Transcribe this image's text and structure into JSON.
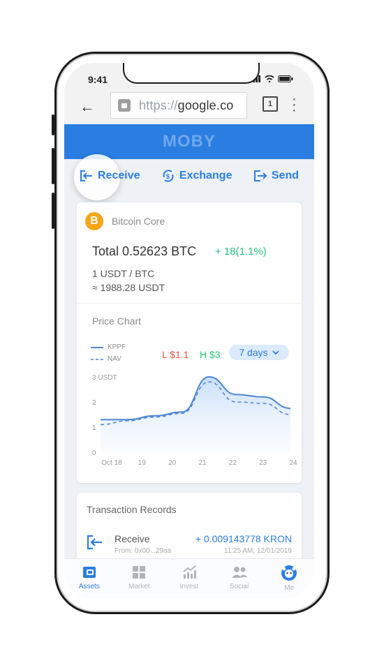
{
  "status_bar": {
    "time": "9:41"
  },
  "browser": {
    "url_prefix": "https://",
    "url_host": "google.co",
    "tab_count": "1"
  },
  "header": {
    "title": "MOBY",
    "color": "#2a7de1"
  },
  "actions": [
    {
      "label": "Receive",
      "icon": "receive-icon"
    },
    {
      "label": "Exchange",
      "icon": "exchange-icon"
    },
    {
      "label": "Send",
      "icon": "send-icon"
    }
  ],
  "wallet": {
    "coin_name": "Bitcoin Core",
    "coin_symbol": "B",
    "total": "Total 0.52623 BTC",
    "change": "+ 18(1.1%)",
    "rate_line1": "1 USDT / BTC",
    "rate_line2": "≈ 1988.28 USDT"
  },
  "price_chart": {
    "title": "Price Chart",
    "low": "L $1.1",
    "high": "H $3",
    "range_label": "7 days"
  },
  "chart_data": {
    "type": "area",
    "x": [
      "Oct 18",
      "19",
      "20",
      "21",
      "22",
      "23",
      "24"
    ],
    "y_ticks": [
      "3 USDT",
      "2",
      "1",
      "0"
    ],
    "ylim": [
      0,
      3
    ],
    "series": [
      {
        "name": "KPPF",
        "style": "solid",
        "values": [
          1.3,
          1.3,
          1.45,
          1.6,
          3.0,
          2.3,
          2.2,
          1.75
        ]
      },
      {
        "name": "NAV",
        "style": "dashed",
        "values": [
          1.1,
          1.25,
          1.4,
          1.55,
          2.8,
          2.0,
          1.95,
          1.5
        ]
      }
    ],
    "legend_position": "top-left"
  },
  "transactions": {
    "title": "Transaction Records",
    "items": [
      {
        "type": "Receive",
        "from": "From: 0x00...29aa",
        "amount": "+ 0.009143778 KRON",
        "date": "11:25 AM, 12/01/2019"
      }
    ]
  },
  "tabbar": [
    {
      "label": "Assets",
      "active": true,
      "icon": "wallet-icon"
    },
    {
      "label": "Market",
      "active": false,
      "icon": "grid-icon"
    },
    {
      "label": "Invest",
      "active": false,
      "icon": "chart-up-icon"
    },
    {
      "label": "Social",
      "active": false,
      "icon": "people-icon"
    },
    {
      "label": "Me",
      "active": false,
      "icon": "avatar-icon"
    }
  ]
}
